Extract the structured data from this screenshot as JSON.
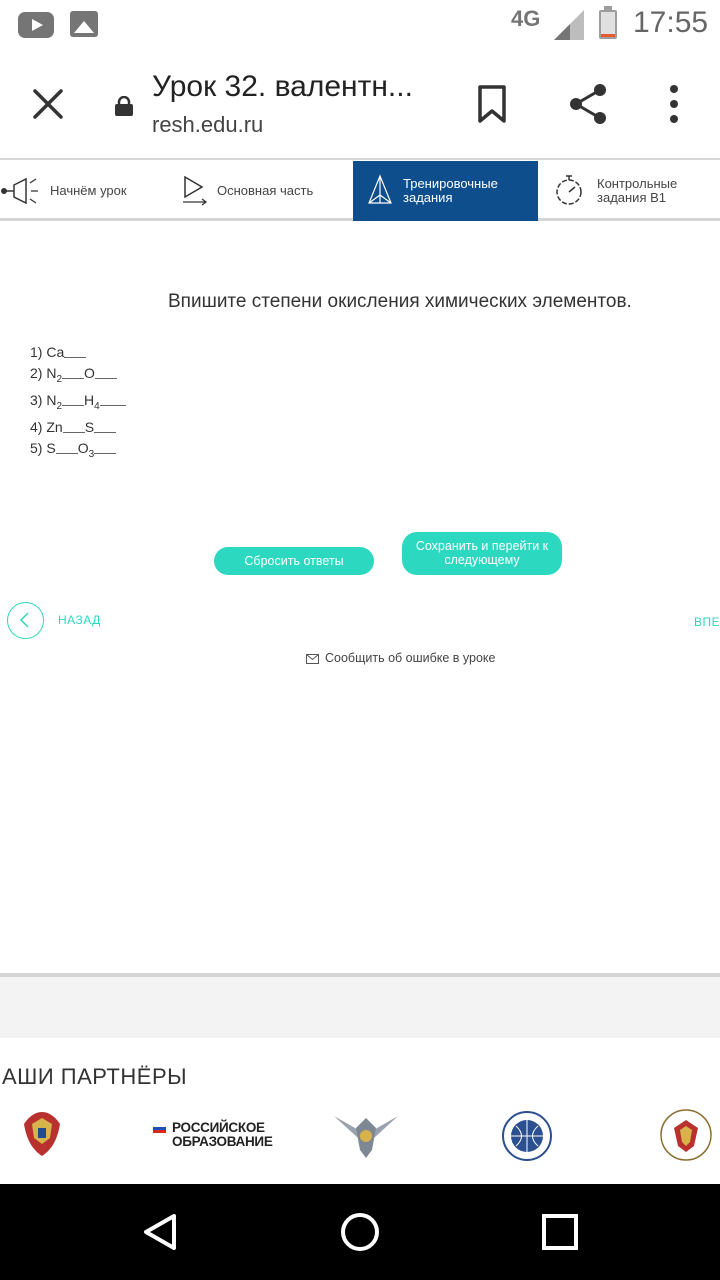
{
  "status_bar": {
    "network": "4G",
    "time": "17:55"
  },
  "browser": {
    "title": "Урок 32. валентн...",
    "url": "resh.edu.ru"
  },
  "tabs": [
    {
      "label": "Начнём урок"
    },
    {
      "label": "Основная часть"
    },
    {
      "label_line1": "Тренировочные",
      "label_line2": "задания"
    },
    {
      "label_line1": "Контрольные",
      "label_line2": "задания В1"
    }
  ],
  "task": {
    "title": "Впишите степени окисления химических элементов.",
    "items": [
      {
        "num": "1)",
        "parts": [
          "Ca"
        ]
      },
      {
        "num": "2)",
        "parts": [
          "N",
          "2",
          "O"
        ]
      },
      {
        "num": "3)",
        "parts": [
          "N",
          "2",
          "H",
          "4"
        ]
      },
      {
        "num": "4)",
        "parts": [
          "Zn",
          "S"
        ]
      },
      {
        "num": "5)",
        "parts": [
          "S",
          "O",
          "3"
        ]
      }
    ]
  },
  "buttons": {
    "reset": "Сбросить ответы",
    "save": "Сохранить и перейти к следующему"
  },
  "nav": {
    "back": "НАЗАД",
    "next": "ВПЕРЁД"
  },
  "report": "Сообщить об ошибке в уроке",
  "partners": {
    "title": "АШИ ПАРТНЁРЫ",
    "ro_line1": "РОССИЙСКОЕ",
    "ro_line2": "ОБРАЗОВАНИЕ"
  },
  "colors": {
    "accent": "#2dd8c0",
    "active_tab": "#0e4e8c"
  }
}
